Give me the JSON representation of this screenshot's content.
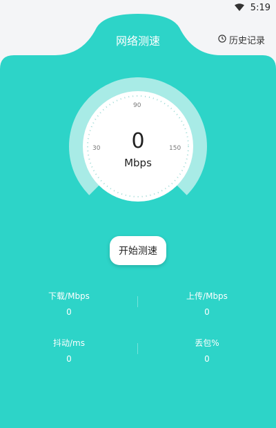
{
  "status_bar": {
    "time": "5:19",
    "wifi_icon": "wifi-icon"
  },
  "header": {
    "title": "网络测速",
    "history_label": "历史记录",
    "history_icon": "clock-icon"
  },
  "gauge": {
    "value": "0",
    "unit": "Mbps",
    "tick_labels": {
      "left": "30",
      "top": "90",
      "right": "150"
    }
  },
  "start_button": {
    "label": "开始测速"
  },
  "stats": {
    "download": {
      "label": "下载/Mbps",
      "value": "0"
    },
    "upload": {
      "label": "上传/Mbps",
      "value": "0"
    },
    "jitter": {
      "label": "抖动/ms",
      "value": "0"
    },
    "packet_loss": {
      "label": "丢包%",
      "value": "0"
    }
  },
  "colors": {
    "accent": "#2dd4c8",
    "ring": "#a8ebe6",
    "background": "#f4f5f7"
  }
}
